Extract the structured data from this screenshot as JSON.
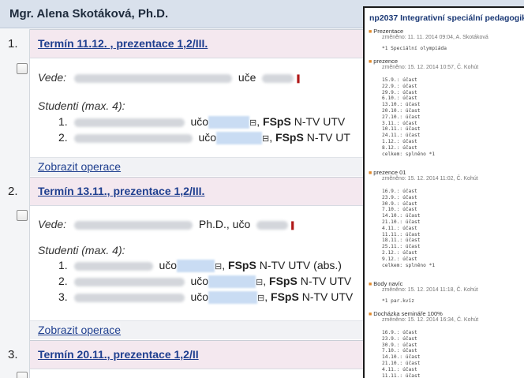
{
  "header": {
    "teacher": "Mgr. Alena Skotáková, Ph.D."
  },
  "terms": [
    {
      "num": "1.",
      "title": "Termín 11.12. , prezentace 1,2/III.",
      "vede_label": "Vede:",
      "vede_suffix": "uče",
      "studenti_label": "Studenti (max. 4):",
      "students": [
        {
          "n": "1.",
          "uco": "učo",
          "fac": "FSpS",
          "prog": "N-TV UTV"
        },
        {
          "n": "2.",
          "uco": "učo",
          "fac": "FSpS",
          "prog": "N-TV UT"
        }
      ],
      "ops": "Zobrazit operace"
    },
    {
      "num": "2.",
      "title": "Termín 13.11., prezentace 1,2/III.",
      "vede_label": "Vede:",
      "vede_mid": "Ph.D., učo",
      "studenti_label": "Studenti (max. 4):",
      "students": [
        {
          "n": "1.",
          "uco": "učo",
          "fac": "FSpS",
          "prog": "N-TV UTV (abs.)"
        },
        {
          "n": "2.",
          "uco": "učo",
          "fac": "FSpS",
          "prog": "N-TV UTV"
        },
        {
          "n": "3.",
          "uco": "učo",
          "fac": "FSpS",
          "prog": "N-TV UTV"
        }
      ],
      "ops": "Zobrazit operace"
    },
    {
      "num": "3.",
      "title": "Termín 20.11., prezentace 1,2/II"
    }
  ],
  "overlay": {
    "title": "np2037 Integrativní speciální pedagogika",
    "sections": [
      {
        "name": "Prezentace",
        "meta": "změněno: 11. 11. 2014 09:04, A. Skotáková",
        "body": "*1 Speciální olympiáda"
      },
      {
        "name": "prezence",
        "meta": "změněno: 15. 12. 2014 10:57, Č. Kohút",
        "body": "15.9.: účast\n22.9.: účast\n29.9.: účast\n6.10.: účast\n13.10.: účast\n20.10.: účast\n27.10.: účast\n3.11.: účast\n10.11.: účast\n24.11.: účast\n1.12.: účast\n8.12.: účast\ncelkem: splněno *1"
      },
      {
        "name": "prezence 01",
        "meta": "změněno: 15. 12. 2014 11:02, Č. Kohút",
        "body": "16.9.: účast\n23.9.: účast\n30.9.: účast\n7.10.: účast\n14.10.: účast\n21.10.: účast\n4.11.: účast\n11.11.: účast\n18.11.: účast\n25.11.: účast\n2.12.: účast\n9.12.: účast\ncelkem: splněno *1"
      },
      {
        "name": "Body navíc",
        "meta": "změněno: 15. 12. 2014 11:18, Č. Kohút",
        "body": "*1 par.kvíz"
      },
      {
        "name": "Docházka semináře 100%",
        "meta": "změněno: 15. 12. 2014 16:34, Č. Kohút",
        "body": "16.9.: účast\n23.9.: účast\n30.9.: účast\n7.10.: účast\n14.10.: účast\n21.10.: účast\n4.11.: účast\n11.11.: účast"
      }
    ]
  }
}
